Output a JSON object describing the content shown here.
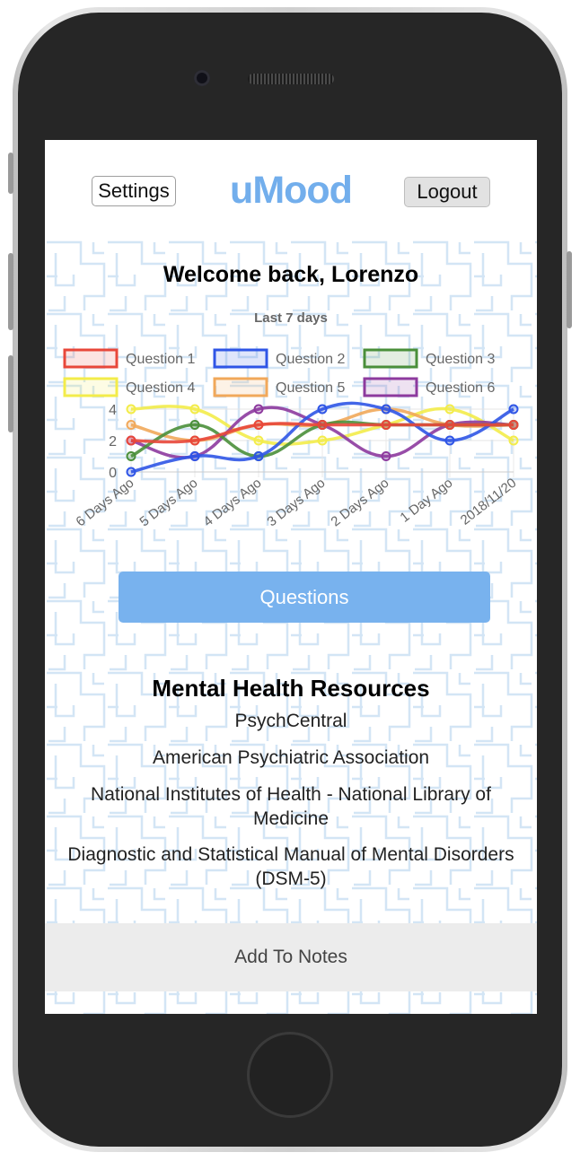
{
  "header": {
    "settings_label": "Settings",
    "logo_text": "uMood",
    "logout_label": "Logout"
  },
  "welcome_text": "Welcome back, Lorenzo",
  "chart_data": {
    "type": "line",
    "title": "Last 7 days",
    "x": [
      "6 Days Ago",
      "5 Days Ago",
      "4 Days Ago",
      "3 Days Ago",
      "2 Days Ago",
      "1 Day Ago",
      "2018/11/20"
    ],
    "ylim": [
      0,
      4
    ],
    "yticks": [
      0,
      2,
      4
    ],
    "grid": true,
    "legend_position": "top",
    "series": [
      {
        "name": "Question 1",
        "color": "#e8473a",
        "values": [
          2,
          2,
          3,
          3,
          3,
          3,
          3
        ]
      },
      {
        "name": "Question 2",
        "color": "#2f55e6",
        "values": [
          0,
          1,
          1,
          4,
          4,
          2,
          4
        ]
      },
      {
        "name": "Question 3",
        "color": "#4a8f3a",
        "values": [
          1,
          3,
          1,
          3,
          3,
          3,
          3
        ]
      },
      {
        "name": "Question 4",
        "color": "#f3ec4a",
        "values": [
          4,
          4,
          2,
          2,
          3,
          4,
          2
        ]
      },
      {
        "name": "Question 5",
        "color": "#f1a85a",
        "values": [
          3,
          2,
          3,
          3,
          4,
          3,
          3
        ]
      },
      {
        "name": "Question 6",
        "color": "#8d3a9e",
        "values": [
          2,
          1,
          4,
          3,
          1,
          3,
          3
        ]
      }
    ]
  },
  "questions_label": "Questions",
  "resources": {
    "title": "Mental Health Resources",
    "links": [
      "PsychCentral",
      "American Psychiatric Association",
      "National Institutes of Health - National Library of Medicine",
      "Diagnostic and Statistical Manual of Mental Disorders (DSM-5)"
    ]
  },
  "notes_label": "Add To Notes"
}
